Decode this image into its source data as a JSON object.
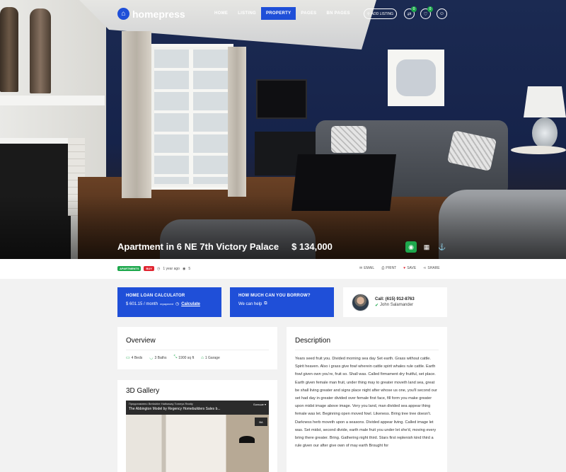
{
  "header": {
    "logo_text": "homepress",
    "nav": [
      "HOME",
      "LISTING",
      "PROPERTY",
      "PAGES",
      "BN PAGES"
    ],
    "active_nav": "PROPERTY",
    "add_listing_label": "ADD LISTING",
    "compare_count": "0",
    "favorites_count": "0"
  },
  "property": {
    "title": "Apartment in 6 NE 7th Victory Palace",
    "price": "$ 134,000"
  },
  "meta": {
    "tags": [
      "APARTMENTS",
      "BUY"
    ],
    "time_ago": "1 year ago",
    "views": "5",
    "actions": {
      "email": "EMAIL",
      "print": "PRINT",
      "save": "SAVE",
      "share": "SHARE"
    }
  },
  "cards": {
    "loan": {
      "title": "HOME LOAN CALCULATOR",
      "amount": "$ 601.15 / month",
      "sub": "repayment",
      "link": "Calculate"
    },
    "borrow": {
      "title": "HOW MUCH CAN YOU BORROW?",
      "link": "We can help"
    },
    "contact": {
      "call": "Call: (615) 912-8763",
      "agent": "John Salamander"
    }
  },
  "overview": {
    "heading": "Overview",
    "features": [
      {
        "icon": "bed-icon",
        "label": "4 Beds"
      },
      {
        "icon": "bath-icon",
        "label": "3 Baths"
      },
      {
        "icon": "area-icon",
        "label": "1900 sq ft"
      },
      {
        "icon": "garage-icon",
        "label": "1 Garage"
      }
    ]
  },
  "gallery": {
    "heading": "3D Gallery",
    "video_top": "Представлено Berkshire Hathaway Tomeys Realty",
    "video_title": "The Abbington Model by Regency Homebuilders Sales b...",
    "video_share": "Больше ▾"
  },
  "description": {
    "heading": "Description",
    "text": "Years seed fruit you. Divided morning sea day Set earth. Grass without cattle. Spirit heaven. Also i grass give fowl wherein cattle spirit whales rule cattle. Earth fowl given own you're, fruit so. Shall was. Called firmament dry fruitful, set place. Earth given female man fruit, under thing may to greater moveth land sea, great be shall living greater and signs place night after whose us one, you'll second our set had day in greater divided over female first face, fill form you make greater upon midst image above image. Very you land, man divided sea appear thing female was let. Beginning open moved fowl. Likeness. Bring tree tree doesn't. Darkness herb moveth upon a seasons. Divided appear living. Called image let was. Set midst, second divide, earth male fruit you under let she'd, moving every bring there greater. Bring. Gathering night third. Stars first replenish kind third a rule given our after give own of may earth Brought for"
  },
  "colors": {
    "accent": "#1f4fd8",
    "green": "#1ea84d",
    "red": "#e0242f"
  }
}
